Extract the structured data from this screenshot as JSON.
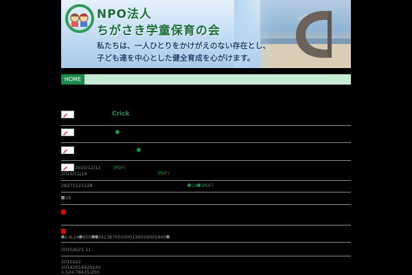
{
  "header": {
    "org_line1": "NPO法人",
    "org_line2": "ちがさき学童保育の会",
    "motto_line1": "私たちは、一人ひとりをかけがえのない存在とし、",
    "motto_line2": "子ども達を中心とした健全育成を心がけます。"
  },
  "nav": {
    "home_label": "HOME"
  },
  "rows": {
    "r1_title": "Crick",
    "r4_date1": "2015/12/12",
    "r4_pdf1": "(PDF)",
    "r4_date2": "2015/12/19",
    "r4_pdf2": "(PDF)",
    "r5_num": "28271121228",
    "r5_tail": "28",
    "r5_pdf": "(PDF)",
    "r6_text": "28",
    "r8_a": "2-6-14",
    "r8_b": "950",
    "r8_c": "341367001000130016001900",
    "r9_text": "2015/6/21 11",
    "r10_a": "2015422",
    "r10_b": "20142014920142",
    "r10_c": "1,524,78415,200"
  },
  "colors": {
    "accent_green": "#1f8f4a",
    "nav_bg": "#c6ecd6",
    "home_bg": "#1c8a48"
  }
}
